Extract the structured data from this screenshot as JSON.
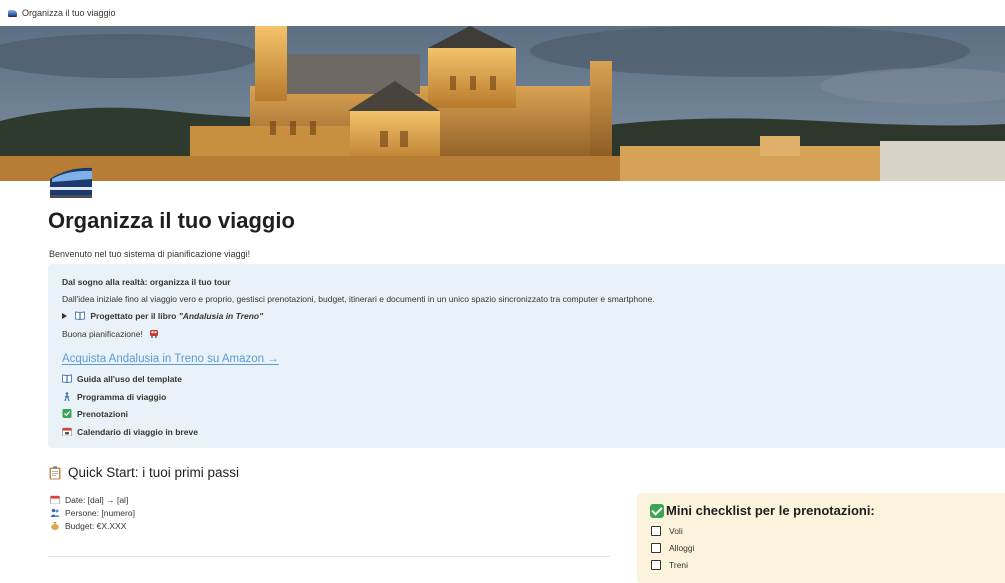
{
  "browser": {
    "tab_title": "Organizza il tuo viaggio"
  },
  "page": {
    "title": "Organizza il tuo viaggio",
    "subtitle": "Benvenuto nel tuo sistema di pianificazione viaggi!"
  },
  "callout": {
    "heading": "Dal sogno alla realtà: organizza il tuo tour",
    "description": "Dall'idea iniziale fino al viaggio vero e proprio, gestisci prenotazioni, budget, itinerari e documenti in un unico spazio sincronizzato tra computer e smartphone.",
    "toggle_prefix": "Progettato per il libro ",
    "toggle_book": "\"Andalusia in Treno\"",
    "sign_off": "Buona pianificazione!",
    "amazon_link": "Acquista Andalusia in Treno su Amazon →",
    "links": [
      {
        "label": "Guida all'uso del template",
        "icon": "book-icon"
      },
      {
        "label": "Programma di viaggio",
        "icon": "person-walking-icon"
      },
      {
        "label": "Prenotazioni",
        "icon": "check-box-icon"
      },
      {
        "label": "Calendario di viaggio in breve",
        "icon": "calendar-icon"
      }
    ]
  },
  "quick_start": {
    "title": "Quick Start: i tuoi primi passi",
    "date_line": "Date: [dal] → [al]",
    "people_line": "Persone: [numero]",
    "budget_line": "Budget: €X.XXX"
  },
  "checklist": {
    "title": "Mini checklist per le prenotazioni:",
    "items": [
      "Voli",
      "Alloggi",
      "Treni"
    ]
  },
  "colors": {
    "callout_bg": "#e9f2f9",
    "link": "#5c9bd6",
    "checklist_bg": "#fbf3db",
    "check_green": "#3aa655"
  }
}
